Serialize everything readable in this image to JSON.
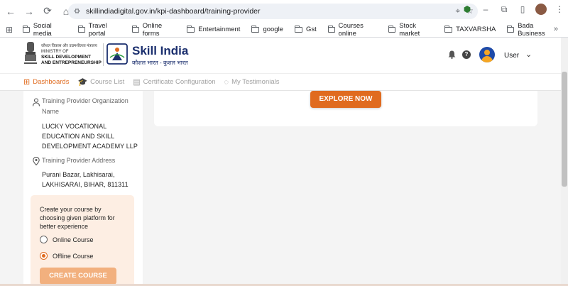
{
  "browser": {
    "url": "skillindiadigital.gov.in/kpi-dashboard/training-provider",
    "bookmarks": [
      "Social media",
      "Travel portal",
      "Online forms",
      "Entertainment",
      "google",
      "Gst",
      "Courses online",
      "Stock market",
      "TAXVARSHA",
      "Bada Business"
    ]
  },
  "header": {
    "ministry_hindi": "कौशल विकास और उद्यमशीलता मंत्रालय",
    "ministry_line1": "MINISTRY OF",
    "ministry_line2": "SKILL DEVELOPMENT",
    "ministry_line3": "AND ENTREPRENEURSHIP",
    "brand": "Skill India",
    "tagline": "कौशल भारत - कुशल भारत",
    "user_label": "User"
  },
  "tabs": [
    {
      "label": "Dashboards",
      "active": true
    },
    {
      "label": "Course List",
      "active": false
    },
    {
      "label": "Certificate Configuration",
      "active": false
    },
    {
      "label": "My Testimonials",
      "active": false
    }
  ],
  "sidebar": {
    "org_label": "Training Provider Organization Name",
    "org_value": "LUCKY VOCATIONAL EDUCATION AND SKILL DEVELOPMENT ACADEMY LLP",
    "address_label": "Training Provider Address",
    "address_value": "Purani Bazar, Lakhisarai, LAKHISARAI, BIHAR, 811311",
    "promo_text": "Create your course by choosing given platform for better experience",
    "option_online": "Online Course",
    "option_offline": "Offline Course",
    "selected_option": "Offline Course",
    "create_button": "CREATE COURSE"
  },
  "main": {
    "explore_button": "EXPLORE NOW"
  },
  "colors": {
    "accent": "#e06b1f",
    "brand_blue": "#1b2f6e",
    "promo_bg": "#fdeee3"
  }
}
